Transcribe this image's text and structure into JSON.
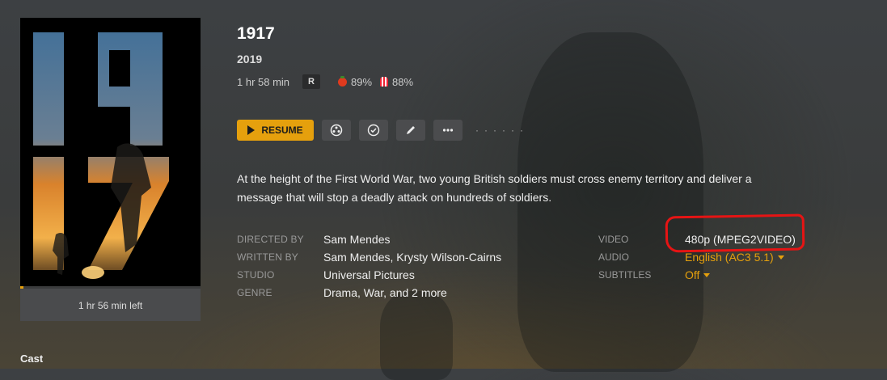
{
  "movie": {
    "title": "1917",
    "year": "2019",
    "duration": "1 hr 58 min",
    "content_rating": "R",
    "critic_score": "89%",
    "audience_score": "88%",
    "summary": "At the height of the First World War, two young British soldiers must cross enemy territory and deliver a message that will stop a deadly attack on hundreds of soldiers.",
    "time_left": "1 hr 56 min left",
    "watch_progress_fraction": 0.02
  },
  "actions": {
    "resume_label": "RESUME",
    "icons": [
      "trailer-icon",
      "mark-watched-icon",
      "edit-icon",
      "more-icon"
    ]
  },
  "details": [
    {
      "label": "DIRECTED BY",
      "value": "Sam Mendes"
    },
    {
      "label": "WRITTEN BY",
      "value": "Sam Mendes, Krysty Wilson-Cairns"
    },
    {
      "label": "STUDIO",
      "value": "Universal Pictures"
    },
    {
      "label": "GENRE",
      "value": "Drama, War, and 2 more"
    }
  ],
  "tech": {
    "video_label": "VIDEO",
    "video_value": "480p (MPEG2VIDEO)",
    "audio_label": "AUDIO",
    "audio_value": "English (AC3 5.1)",
    "subtitles_label": "SUBTITLES",
    "subtitles_value": "Off"
  },
  "poster": {
    "numerals_top": "19",
    "numerals_bottom": "17"
  },
  "sections": {
    "cast_heading": "Cast"
  },
  "colors": {
    "accent": "#e5a00d",
    "annotation": "#e61414"
  }
}
